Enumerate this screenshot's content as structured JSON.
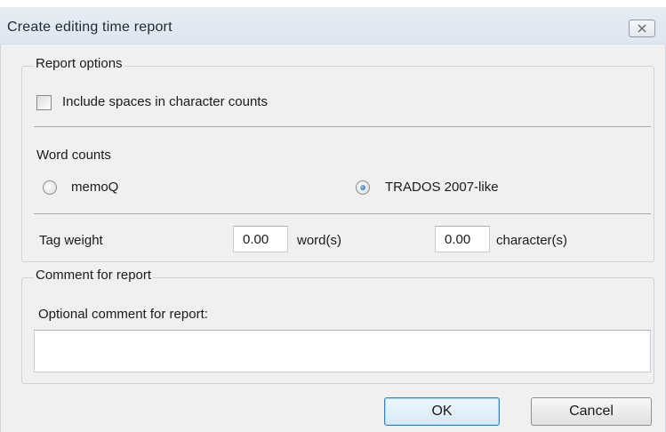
{
  "window": {
    "title": "Create editing time report",
    "close_icon": "close-icon"
  },
  "report_options": {
    "legend": "Report options",
    "include_spaces": {
      "label": "Include spaces in character counts",
      "checked": false
    },
    "word_counts_label": "Word counts",
    "word_counts_options": [
      {
        "label": "memoQ",
        "selected": false
      },
      {
        "label": "TRADOS 2007-like",
        "selected": true
      }
    ],
    "tag_weight": {
      "label": "Tag weight",
      "words_value": "0.00",
      "words_unit": "word(s)",
      "chars_value": "0.00",
      "chars_unit": "character(s)"
    }
  },
  "comment": {
    "legend": "Comment for report",
    "label": "Optional comment for report:",
    "value": ""
  },
  "buttons": {
    "ok": "OK",
    "cancel": "Cancel"
  },
  "colors": {
    "titlebar": "#dfe6ef",
    "dialog_bg": "#f0f0f0",
    "radio_selected": "#1f5da8"
  }
}
